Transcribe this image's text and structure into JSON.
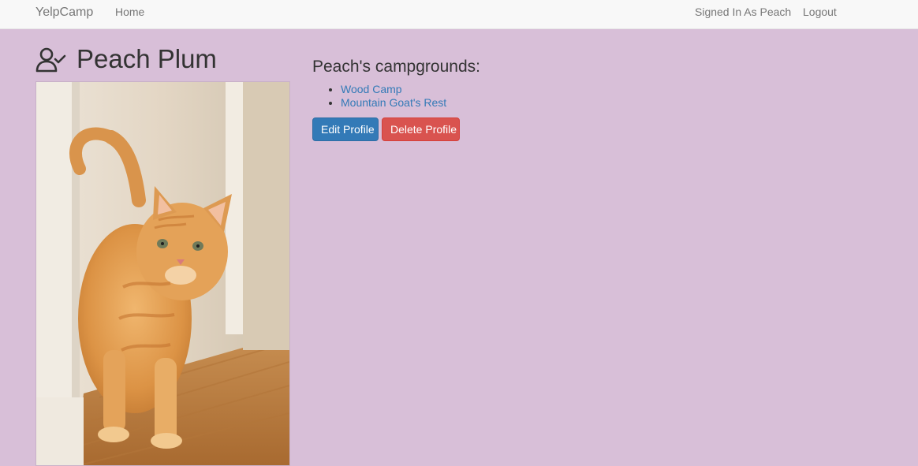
{
  "navbar": {
    "brand": "YelpCamp",
    "home": "Home",
    "signed_in": "Signed In As Peach",
    "logout": "Logout"
  },
  "profile": {
    "icon": "user-check-icon",
    "name": "Peach Plum",
    "photo": "orange-tabby-cat-photo"
  },
  "campgrounds": {
    "heading": "Peach's campgrounds:",
    "items": [
      {
        "label": "Wood Camp"
      },
      {
        "label": "Mountain Goat's Rest"
      }
    ]
  },
  "actions": {
    "edit": "Edit Profile",
    "delete": "Delete Profile"
  },
  "colors": {
    "background": "#d8bfd8",
    "navbar": "#f8f8f8",
    "link": "#337ab7",
    "primary": "#337ab7",
    "danger": "#d9534f"
  }
}
